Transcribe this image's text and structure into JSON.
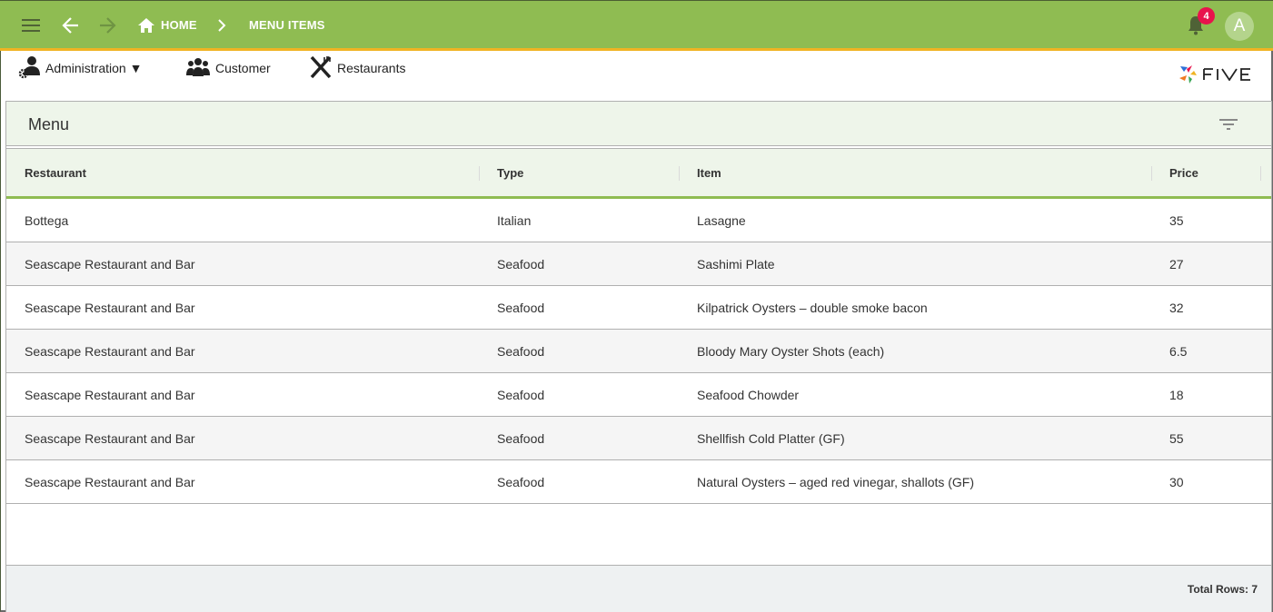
{
  "topbar": {
    "menu_icon": "hamburger-icon",
    "back_icon": "arrow-left-icon",
    "forward_icon": "arrow-right-icon",
    "breadcrumb": [
      {
        "label": "HOME",
        "icon": "home-icon"
      },
      {
        "label": "MENU ITEMS"
      }
    ],
    "notifications": {
      "icon": "bell-icon",
      "count": "4"
    },
    "avatar_letter": "A",
    "colors": {
      "bar": "#8fbc52",
      "accent": "#f0b323",
      "badge": "#e8134c"
    }
  },
  "menubar": {
    "items": [
      {
        "label": "Administration ▼",
        "icon": "admin-user-gear-icon"
      },
      {
        "label": "Customer",
        "icon": "users-group-icon"
      },
      {
        "label": "Restaurants",
        "icon": "fork-knife-icon"
      }
    ],
    "logo_text": "FIVE"
  },
  "panel": {
    "title": "Menu",
    "filter_icon": "filter-icon",
    "columns": [
      "Restaurant",
      "Type",
      "Item",
      "Price"
    ],
    "rows": [
      {
        "restaurant": "Bottega",
        "type": "Italian",
        "item": "Lasagne",
        "price": "35"
      },
      {
        "restaurant": "Seascape Restaurant and Bar",
        "type": "Seafood",
        "item": "Sashimi Plate",
        "price": "27"
      },
      {
        "restaurant": "Seascape Restaurant and Bar",
        "type": "Seafood",
        "item": "Kilpatrick Oysters – double smoke bacon",
        "price": "32"
      },
      {
        "restaurant": "Seascape Restaurant and Bar",
        "type": "Seafood",
        "item": "Bloody Mary Oyster Shots (each)",
        "price": "6.5"
      },
      {
        "restaurant": "Seascape Restaurant and Bar",
        "type": "Seafood",
        "item": "Seafood Chowder",
        "price": "18"
      },
      {
        "restaurant": "Seascape Restaurant and Bar",
        "type": "Seafood",
        "item": "Shellfish Cold Platter (GF)",
        "price": "55"
      },
      {
        "restaurant": "Seascape Restaurant and Bar",
        "type": "Seafood",
        "item": "Natural Oysters – aged red vinegar, shallots (GF)",
        "price": "30"
      }
    ],
    "footer": "Total Rows: 7"
  }
}
